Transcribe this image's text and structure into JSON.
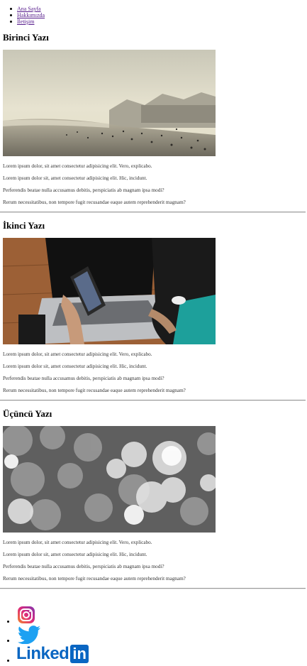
{
  "nav": {
    "items": [
      {
        "label": "Ana Sayfa"
      },
      {
        "label": "Hakkımızda"
      },
      {
        "label": "İletişim"
      }
    ]
  },
  "posts": [
    {
      "title": "Birinci Yazı",
      "image": "beach-photo",
      "paragraphs": [
        "Lorem ipsum dolor, sit amet consectetur adipisicing elit. Vero, explicabo.",
        "Lorem ipsum dolor sit, amet consectetur adipisicing elit. Hic, incidunt.",
        "Perferendis beatae nulla accusamus debitis, perspiciatis ab magnam ipsa modi?",
        "Rerum necessitatibus, non tempore fugit recusandae eaque autem reprehenderit magnam?"
      ]
    },
    {
      "title": "İkinci Yazı",
      "image": "laptop-phone-photo",
      "paragraphs": [
        "Lorem ipsum dolor, sit amet consectetur adipisicing elit. Vero, explicabo.",
        "Lorem ipsum dolor sit, amet consectetur adipisicing elit. Hic, incidunt.",
        "Perferendis beatae nulla accusamus debitis, perspiciatis ab magnam ipsa modi?",
        "Rerum necessitatibus, non tempore fugit recusandae eaque autem reprehenderit magnam?"
      ]
    },
    {
      "title": "Üçüncü Yazı",
      "image": "bokeh-photo",
      "paragraphs": [
        "Lorem ipsum dolor, sit amet consectetur adipisicing elit. Vero, explicabo.",
        "Lorem ipsum dolor sit, amet consectetur adipisicing elit. Hic, incidunt.",
        "Perferendis beatae nulla accusamus debitis, perspiciatis ab magnam ipsa modi?",
        "Rerum necessitatibus, non tempore fugit recusandae eaque autem reprehenderit magnam?"
      ]
    }
  ],
  "social": {
    "instagram_icon": "instagram-icon",
    "twitter_icon": "twitter-icon",
    "linkedin_logo": {
      "text_main": "Linked",
      "text_box": "in",
      "color": "#0a66c2"
    },
    "twitter_color": "#1da1f2",
    "instagram_colors": [
      "#f58529",
      "#dd2a7b",
      "#8134af"
    ]
  },
  "colors": {
    "link": "#551a8b",
    "text": "#333333"
  }
}
